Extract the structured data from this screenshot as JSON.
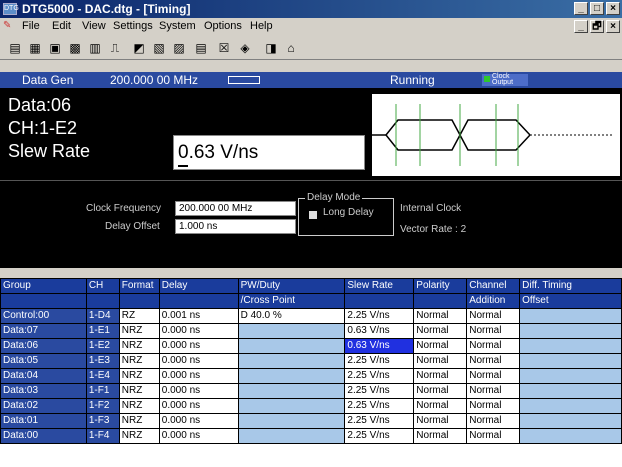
{
  "window": {
    "title": "DTG5000 - DAC.dtg - [Timing]",
    "app_icon_text": "DTG",
    "controls": [
      "_",
      "□",
      "×"
    ],
    "doc_controls": [
      "_",
      "🗗",
      "×"
    ]
  },
  "menu": {
    "items": [
      "File",
      "Edit",
      "View",
      "Settings",
      "System",
      "Options",
      "Help"
    ]
  },
  "toolbar": {
    "icons": [
      "open-icon",
      "save-icon",
      "print-icon",
      "grid-icon",
      "table-icon",
      "waveform-icon",
      "chart-icon",
      "block-icon",
      "sequence-icon",
      "pattern-icon",
      "timing-icon",
      "run-icon",
      "home-icon"
    ]
  },
  "status": {
    "mode": "Data Gen",
    "frequency": "200.000 00 MHz",
    "state": "Running",
    "clock_output": "Clock Output"
  },
  "channel": {
    "name": "Data:06",
    "ch": "CH:1-E2",
    "param": "Slew Rate",
    "value": "0.63 V/ns"
  },
  "settings": {
    "clock_freq_label": "Clock Frequency",
    "clock_freq_value": "200.000 00 MHz",
    "delay_offset_label": "Delay Offset",
    "delay_offset_value": "1.000 ns",
    "delay_mode_label": "Delay Mode",
    "long_delay_label": "Long Delay",
    "internal_clock": "Internal Clock",
    "vector_rate": "Vector Rate : 2"
  },
  "table": {
    "headers": [
      "Group",
      "CH",
      "Format",
      "Delay",
      "PW/Duty",
      "Slew Rate",
      "Polarity",
      "Channel",
      "Diff. Timing"
    ],
    "subheaders": [
      "",
      "",
      "",
      "",
      "/Cross Point",
      "",
      "",
      "Addition",
      "Offset"
    ],
    "rows": [
      [
        "Control:00",
        "1-D4",
        "RZ",
        "0.001 ns",
        "D 40.0 %",
        "2.25 V/ns",
        "Normal",
        "Normal",
        ""
      ],
      [
        "Data:07",
        "1-E1",
        "NRZ",
        "0.000 ns",
        "",
        "0.63 V/ns",
        "Normal",
        "Normal",
        ""
      ],
      [
        "Data:06",
        "1-E2",
        "NRZ",
        "0.000 ns",
        "",
        "0.63 V/ns",
        "Normal",
        "Normal",
        ""
      ],
      [
        "Data:05",
        "1-E3",
        "NRZ",
        "0.000 ns",
        "",
        "2.25 V/ns",
        "Normal",
        "Normal",
        ""
      ],
      [
        "Data:04",
        "1-E4",
        "NRZ",
        "0.000 ns",
        "",
        "2.25 V/ns",
        "Normal",
        "Normal",
        ""
      ],
      [
        "Data:03",
        "1-F1",
        "NRZ",
        "0.000 ns",
        "",
        "2.25 V/ns",
        "Normal",
        "Normal",
        ""
      ],
      [
        "Data:02",
        "1-F2",
        "NRZ",
        "0.000 ns",
        "",
        "2.25 V/ns",
        "Normal",
        "Normal",
        ""
      ],
      [
        "Data:01",
        "1-F3",
        "NRZ",
        "0.000 ns",
        "",
        "2.25 V/ns",
        "Normal",
        "Normal",
        ""
      ],
      [
        "Data:00",
        "1-F4",
        "NRZ",
        "0.000 ns",
        "",
        "2.25 V/ns",
        "Normal",
        "Normal",
        ""
      ]
    ]
  },
  "colors": {
    "status_bar": "#2a4aa0",
    "selected_cell": "#2030e0",
    "light_cell": "#a8c8e8"
  }
}
